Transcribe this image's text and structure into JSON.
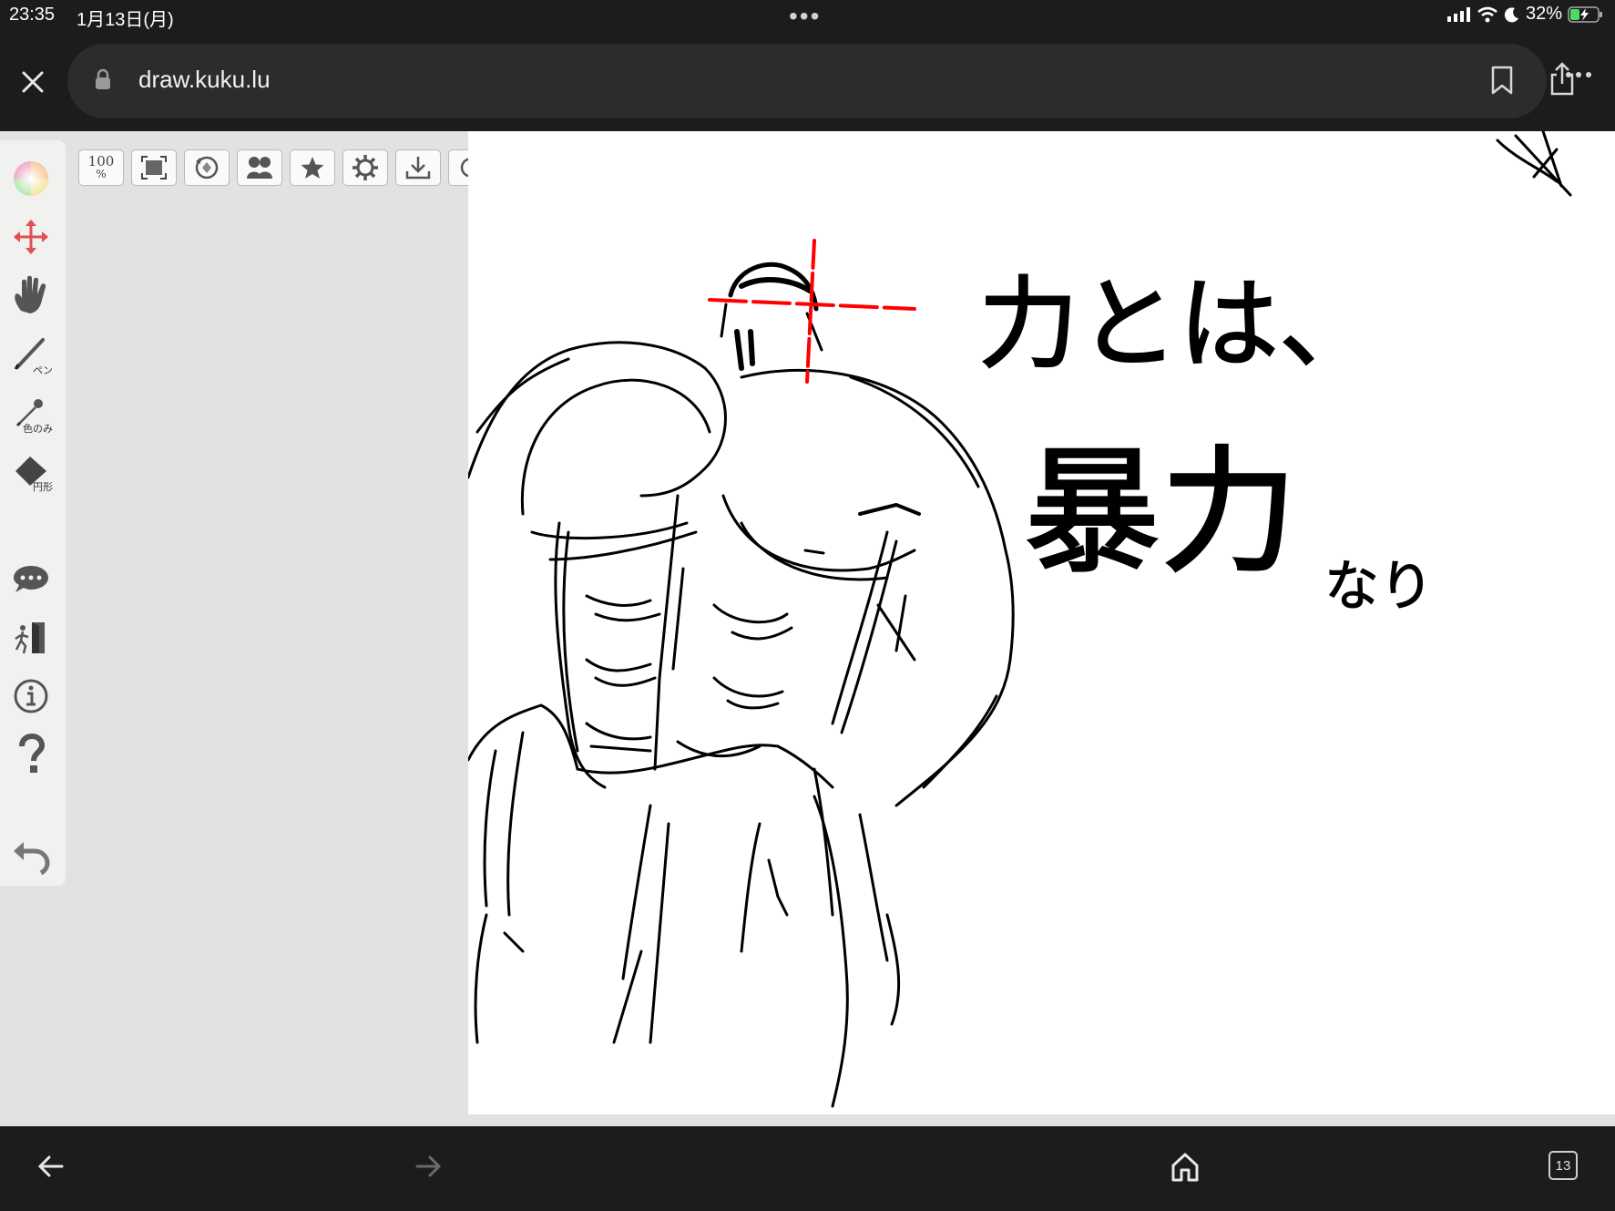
{
  "status": {
    "time": "23:35",
    "date": "1月13日(月)",
    "battery": "32%"
  },
  "browser": {
    "url": "draw.kuku.lu",
    "tab_count": "13"
  },
  "toolbar": {
    "zoom": "100",
    "zoom_unit": "%",
    "pen_label": "ペン",
    "eyedropper_label": "色のみ",
    "shape_label": "円形"
  },
  "canvas": {
    "drawing_text_1": "力とは、",
    "drawing_text_2": "暴力",
    "drawing_text_3": "なり"
  },
  "colors": {
    "chrome": "#1c1c1e",
    "panel": "#e2e2e0",
    "accent_red": "#e05050",
    "ink": "#000000",
    "stroke_red": "#ff0000"
  }
}
